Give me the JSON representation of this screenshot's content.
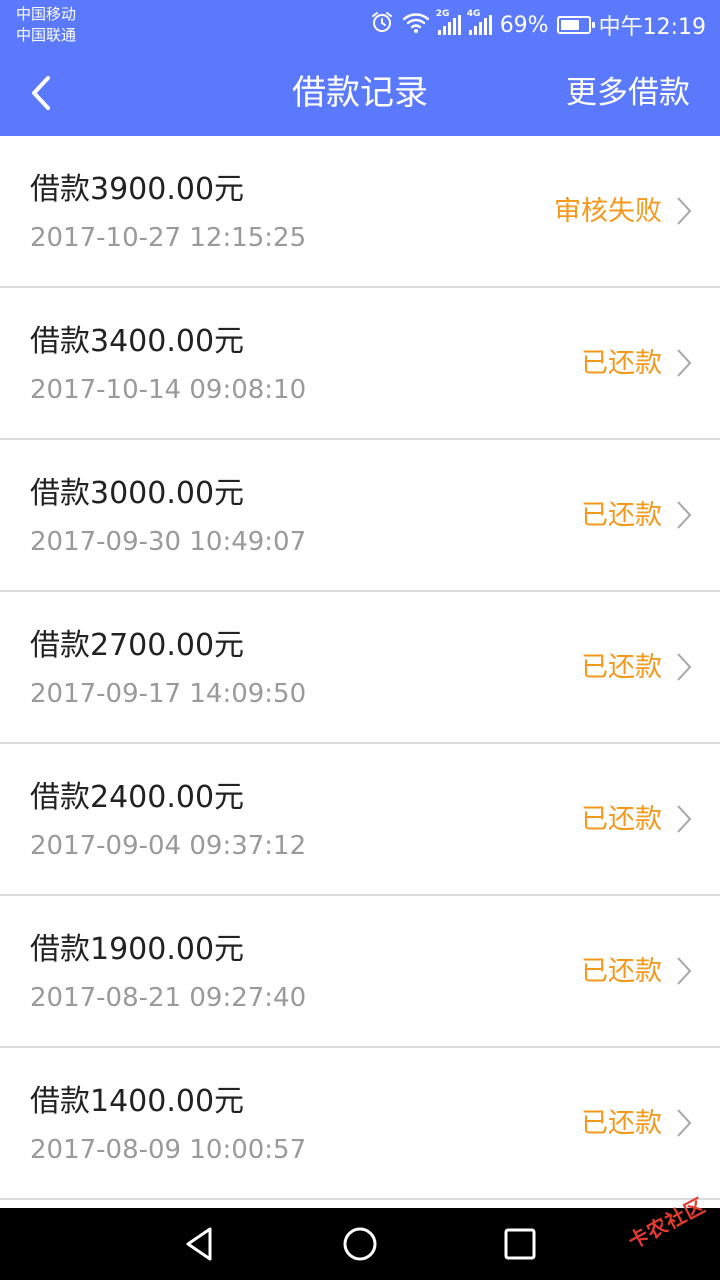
{
  "status_bar": {
    "carrier_1": "中国移动",
    "carrier_2": "中国联通",
    "network_1": "2G",
    "network_2": "4G",
    "battery": "69%",
    "battery_level": 0.69,
    "time": "中午12:19"
  },
  "header": {
    "title": "借款记录",
    "more_label": "更多借款",
    "background_color": "#5b79fc"
  },
  "loans": [
    {
      "amount": "借款3900.00元",
      "date": "2017-10-27 12:15:25",
      "status": "审核失败"
    },
    {
      "amount": "借款3400.00元",
      "date": "2017-10-14 09:08:10",
      "status": "已还款"
    },
    {
      "amount": "借款3000.00元",
      "date": "2017-09-30 10:49:07",
      "status": "已还款"
    },
    {
      "amount": "借款2700.00元",
      "date": "2017-09-17 14:09:50",
      "status": "已还款"
    },
    {
      "amount": "借款2400.00元",
      "date": "2017-09-04 09:37:12",
      "status": "已还款"
    },
    {
      "amount": "借款1900.00元",
      "date": "2017-08-21 09:27:40",
      "status": "已还款"
    },
    {
      "amount": "借款1400.00元",
      "date": "2017-08-09 10:00:57",
      "status": "已还款"
    }
  ],
  "status_color": "#f39a1e",
  "watermark": "卡农社区"
}
